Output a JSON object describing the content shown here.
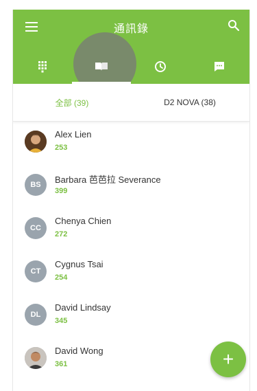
{
  "appbar": {
    "title": "通訊錄",
    "menu_icon": "menu-icon",
    "search_icon": "search-icon",
    "background": "#7cc043"
  },
  "tabs": [
    {
      "icon": "dialpad-icon",
      "active": false
    },
    {
      "icon": "contacts-book-icon",
      "active": true
    },
    {
      "icon": "clock-icon",
      "active": false
    },
    {
      "icon": "message-icon",
      "active": false
    }
  ],
  "subtabs": {
    "all_label": "全部 (39)",
    "nova_label": "D2 NOVA (38)"
  },
  "contacts": [
    {
      "name": "Alex Lien",
      "ext": "253",
      "initials": "",
      "photo": true
    },
    {
      "name": "Barbara 芭芭拉 Severance",
      "ext": "399",
      "initials": "BS",
      "photo": false
    },
    {
      "name": "Chenya Chien",
      "ext": "272",
      "initials": "CC",
      "photo": false
    },
    {
      "name": "Cygnus Tsai",
      "ext": "254",
      "initials": "CT",
      "photo": false
    },
    {
      "name": "David Lindsay",
      "ext": "345",
      "initials": "DL",
      "photo": false
    },
    {
      "name": "David Wong",
      "ext": "361",
      "initials": "",
      "photo": true
    }
  ],
  "fab": {
    "icon": "plus-icon",
    "label": "+"
  },
  "colors": {
    "accent": "#7cc043",
    "avatar_bg": "#9aa4ad"
  }
}
